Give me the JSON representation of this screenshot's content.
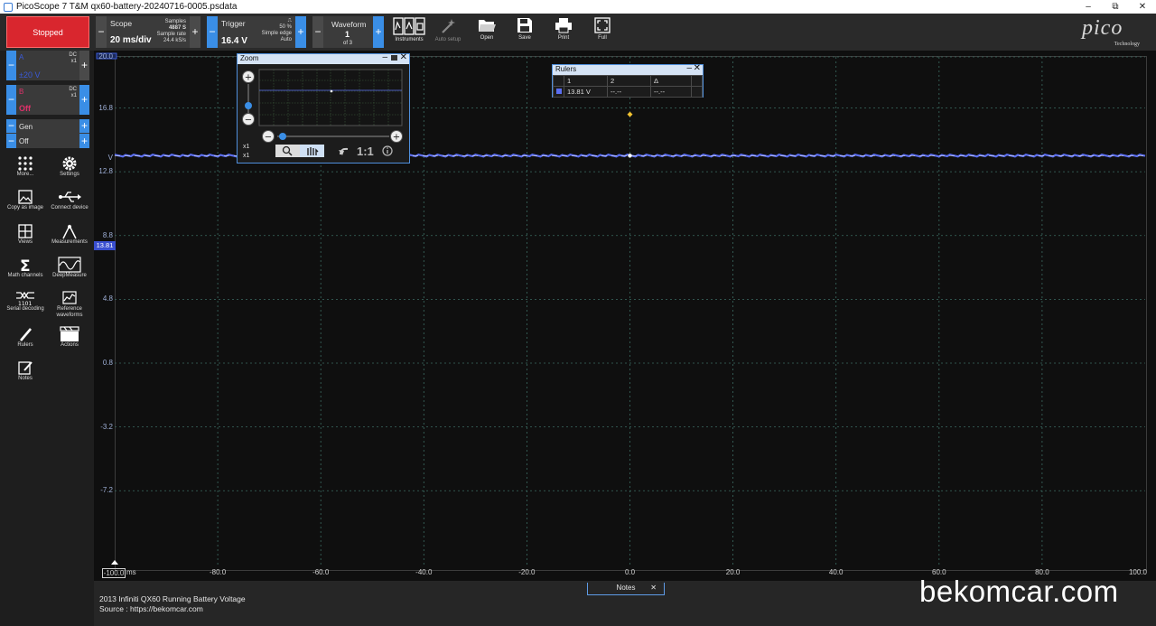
{
  "window": {
    "title": "PicoScope 7 T&M qx60-battery-20240716-0005.psdata",
    "controls": [
      "–",
      "⧉",
      "✕"
    ]
  },
  "toolbar": {
    "status": "Stopped",
    "scope": {
      "label": "Scope",
      "timebase": "20 ms/div",
      "samples_label": "Samples",
      "samples": "4887 S",
      "rate_label": "Sample rate",
      "rate": "24.4 kS/s"
    },
    "trigger": {
      "label": "Trigger",
      "level": "16.4 V",
      "percent": "50 %",
      "type": "Simple edge",
      "mode": "Auto"
    },
    "waveform": {
      "label": "Waveform",
      "current": "1",
      "of": "of 3"
    },
    "buttons": [
      {
        "id": "instruments",
        "label": "Instruments",
        "icon": "instruments-icon"
      },
      {
        "id": "autosetup",
        "label": "Auto setup",
        "icon": "wand-icon"
      },
      {
        "id": "open",
        "label": "Open",
        "icon": "folder-icon"
      },
      {
        "id": "save",
        "label": "Save",
        "icon": "save-icon"
      },
      {
        "id": "print",
        "label": "Print",
        "icon": "printer-icon"
      },
      {
        "id": "full",
        "label": "Full",
        "icon": "fullscreen-icon"
      }
    ],
    "logo": {
      "word": "pico",
      "sub": "Technology"
    }
  },
  "channels": {
    "a": {
      "name": "A",
      "range": "±20 V",
      "coupling": "DC",
      "probe": "x1",
      "color": "#3a4fd0"
    },
    "b": {
      "name": "B",
      "range": "Off",
      "coupling": "DC",
      "probe": "x1",
      "color": "#e0306a"
    },
    "gen": {
      "name": "Gen",
      "state": "Off"
    }
  },
  "sidebar": [
    {
      "label": "More...",
      "icon": "grid-dots-icon"
    },
    {
      "label": "Settings",
      "icon": "gear-icon"
    },
    {
      "label": "Copy as image",
      "icon": "image-icon"
    },
    {
      "label": "Connect device",
      "icon": "usb-icon"
    },
    {
      "label": "Views",
      "icon": "views-icon"
    },
    {
      "label": "Measurements",
      "icon": "measurements-icon"
    },
    {
      "label": "Math channels",
      "icon": "sigma-icon"
    },
    {
      "label": "DeepMeasure",
      "icon": "deepmeasure-icon"
    },
    {
      "label": "Serial decoding",
      "icon": "serial-icon"
    },
    {
      "label": "Reference waveforms",
      "icon": "reference-icon"
    },
    {
      "label": "Rulers",
      "icon": "ruler-icon"
    },
    {
      "label": "Actions",
      "icon": "clapper-icon"
    },
    {
      "label": "Notes",
      "icon": "notes-icon"
    }
  ],
  "axes": {
    "y_unit": "V",
    "y_ticks": [
      "20.0",
      "16.8",
      "12.8",
      "8.8",
      "4.8",
      "0.8",
      "-3.2",
      "-7.2"
    ],
    "x_unit": "ms",
    "x_ticks": [
      "-100.0",
      "-80.0",
      "-60.0",
      "-40.0",
      "-20.0",
      "0.0",
      "20.0",
      "40.0",
      "60.0",
      "80.0",
      "100.0"
    ],
    "ruler_marker": "13.81"
  },
  "chart_data": {
    "type": "line",
    "x_range_ms": [
      -100,
      100
    ],
    "y_range_v": [
      -12,
      20
    ],
    "series": [
      {
        "channel": "A",
        "value_v": 13.81,
        "color": "#5b6ef0"
      }
    ],
    "trigger_point": {
      "x_ms": 0,
      "y_v": 16.4
    },
    "grid": true
  },
  "zoom_panel": {
    "title": "Zoom",
    "x_factor": "x1",
    "y_factor": "x1",
    "ratio": "1:1"
  },
  "rulers_panel": {
    "title": "Rulers",
    "headers": [
      "",
      "1",
      "2",
      "Δ"
    ],
    "row": [
      "",
      "13.81 V",
      "--.--",
      "--.--"
    ],
    "row_color": "#5b6ef0"
  },
  "notes": {
    "tab": "Notes",
    "line1": "2013 Infiniti QX60 Running Battery Voltage",
    "line2": "Source : https://bekomcar.com"
  },
  "watermark": "bekomcar.com"
}
